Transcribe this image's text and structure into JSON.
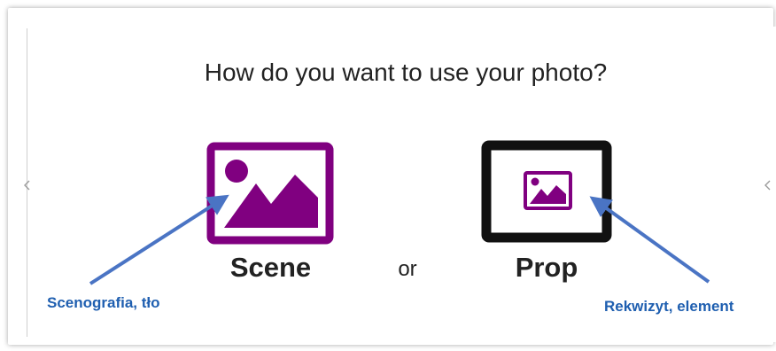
{
  "dialog": {
    "prompt": "How do you want to use your photo?",
    "scene_label": "Scene",
    "or_label": "or",
    "prop_label": "Prop"
  },
  "annotations": {
    "scene_note": "Scenografia, tło",
    "prop_note": "Rekwizyt, element"
  },
  "colors": {
    "accent_purple": "#800080",
    "frame_black": "#111111",
    "arrow_blue": "#4a74c4",
    "annotation_blue": "#1f5fb0"
  },
  "icons": {
    "scene": "image-icon",
    "prop": "image-icon",
    "nav_left": "chevron-left-icon",
    "nav_right": "chevron-right-icon"
  }
}
